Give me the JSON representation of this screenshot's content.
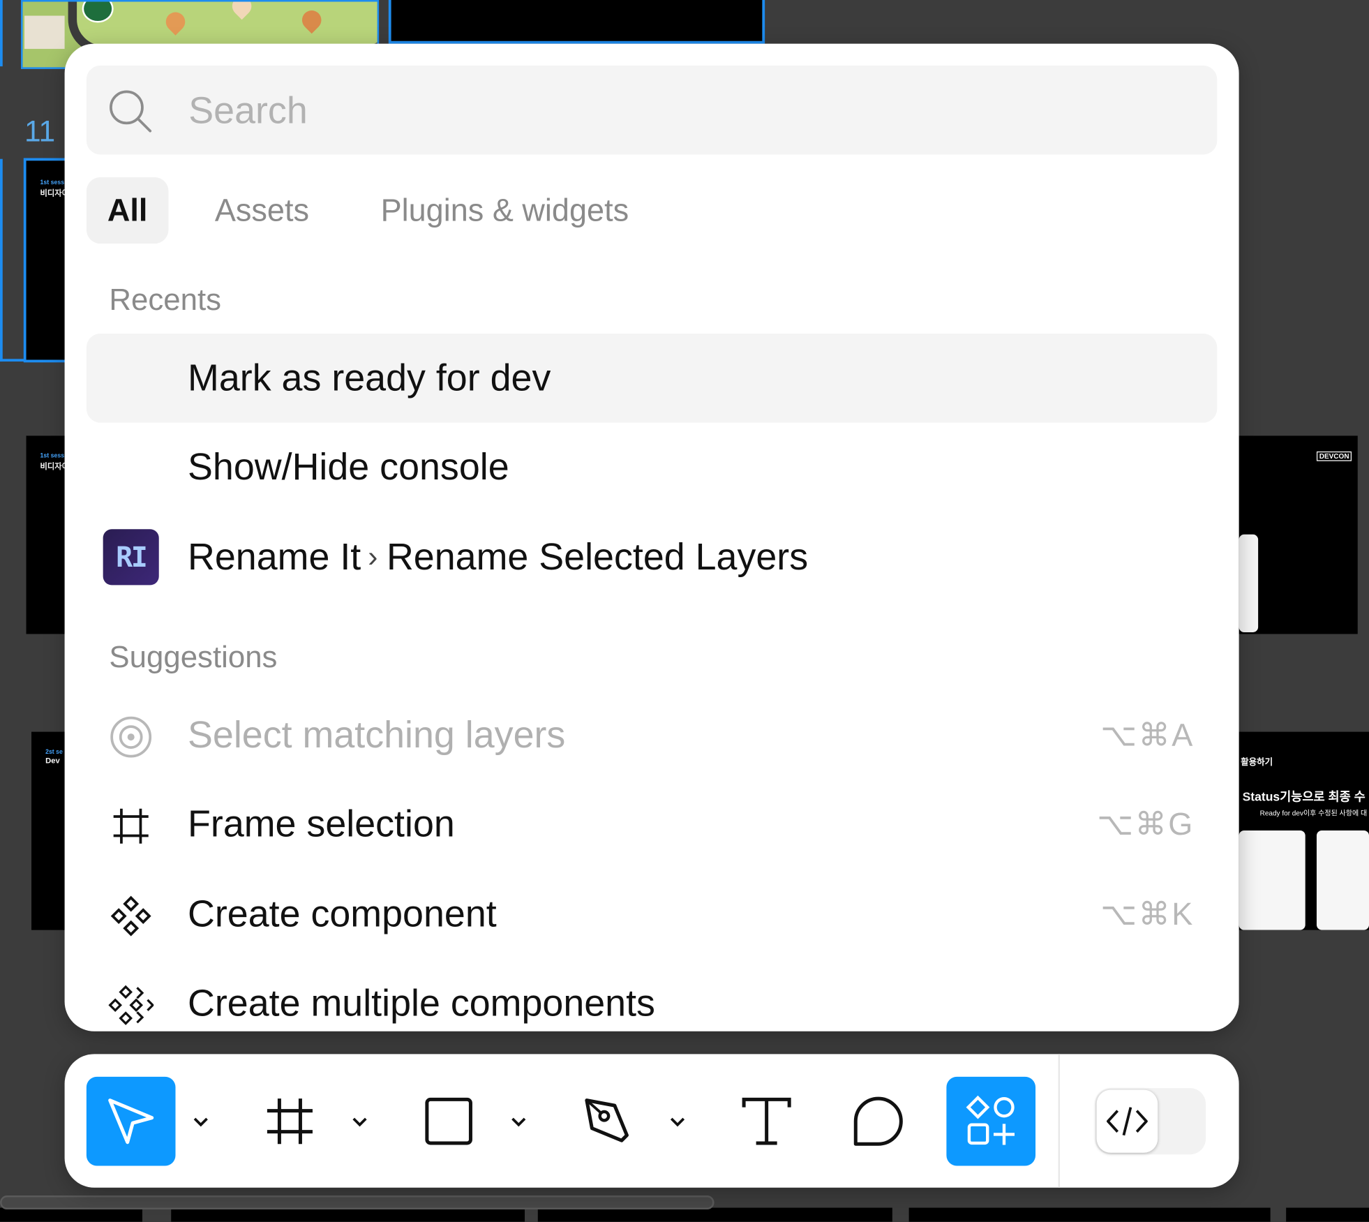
{
  "canvas": {
    "frame_number": "11",
    "frame_texts": [
      "1st sess",
      "비디자이",
      "1st sess",
      "비디자이",
      "2st se",
      "Dev"
    ],
    "right_frame_texts": {
      "devcon": "DEVCON",
      "title_small": "활용하기",
      "headline": "Status기능으로 최종 수",
      "subline": "Ready for dev이후 수정된 사항에 대"
    }
  },
  "palette": {
    "search": {
      "placeholder": "Search",
      "value": ""
    },
    "tabs": [
      {
        "label": "All",
        "active": true
      },
      {
        "label": "Assets",
        "active": false
      },
      {
        "label": "Plugins & widgets",
        "active": false
      }
    ],
    "recents": {
      "title": "Recents",
      "items": [
        {
          "label": "Mark as ready for dev",
          "highlighted": true
        },
        {
          "label": "Show/Hide console"
        },
        {
          "plugin": "Rename It",
          "plugin_badge": "RI",
          "command": "Rename Selected Layers"
        }
      ]
    },
    "suggestions": {
      "title": "Suggestions",
      "items": [
        {
          "label": "Select matching layers",
          "shortcut": "⌥⌘A",
          "icon": "target-icon",
          "disabled": true
        },
        {
          "label": "Frame selection",
          "shortcut": "⌥⌘G",
          "icon": "frame-icon"
        },
        {
          "label": "Create component",
          "shortcut": "⌥⌘K",
          "icon": "component-icon"
        },
        {
          "label": "Create multiple components",
          "icon": "multiple-components-icon"
        }
      ]
    }
  },
  "toolbar": {
    "tools": [
      {
        "name": "move-tool",
        "icon": "cursor-arrow-icon",
        "active": true,
        "has_dropdown": true
      },
      {
        "name": "frame-tool",
        "icon": "frame-icon",
        "has_dropdown": true
      },
      {
        "name": "shape-tool",
        "icon": "rectangle-icon",
        "has_dropdown": true
      },
      {
        "name": "pen-tool",
        "icon": "pen-icon",
        "has_dropdown": true
      },
      {
        "name": "text-tool",
        "icon": "text-icon"
      },
      {
        "name": "comment-tool",
        "icon": "comment-bubble-icon"
      },
      {
        "name": "actions-tool",
        "icon": "shapes-plus-icon",
        "active": true
      }
    ],
    "dev_mode": {
      "icon": "code-brackets-icon",
      "enabled": false
    }
  },
  "colors": {
    "accent": "#0d99ff",
    "canvas_bg": "#3c3c3c",
    "selection": "#1d8cf0"
  }
}
